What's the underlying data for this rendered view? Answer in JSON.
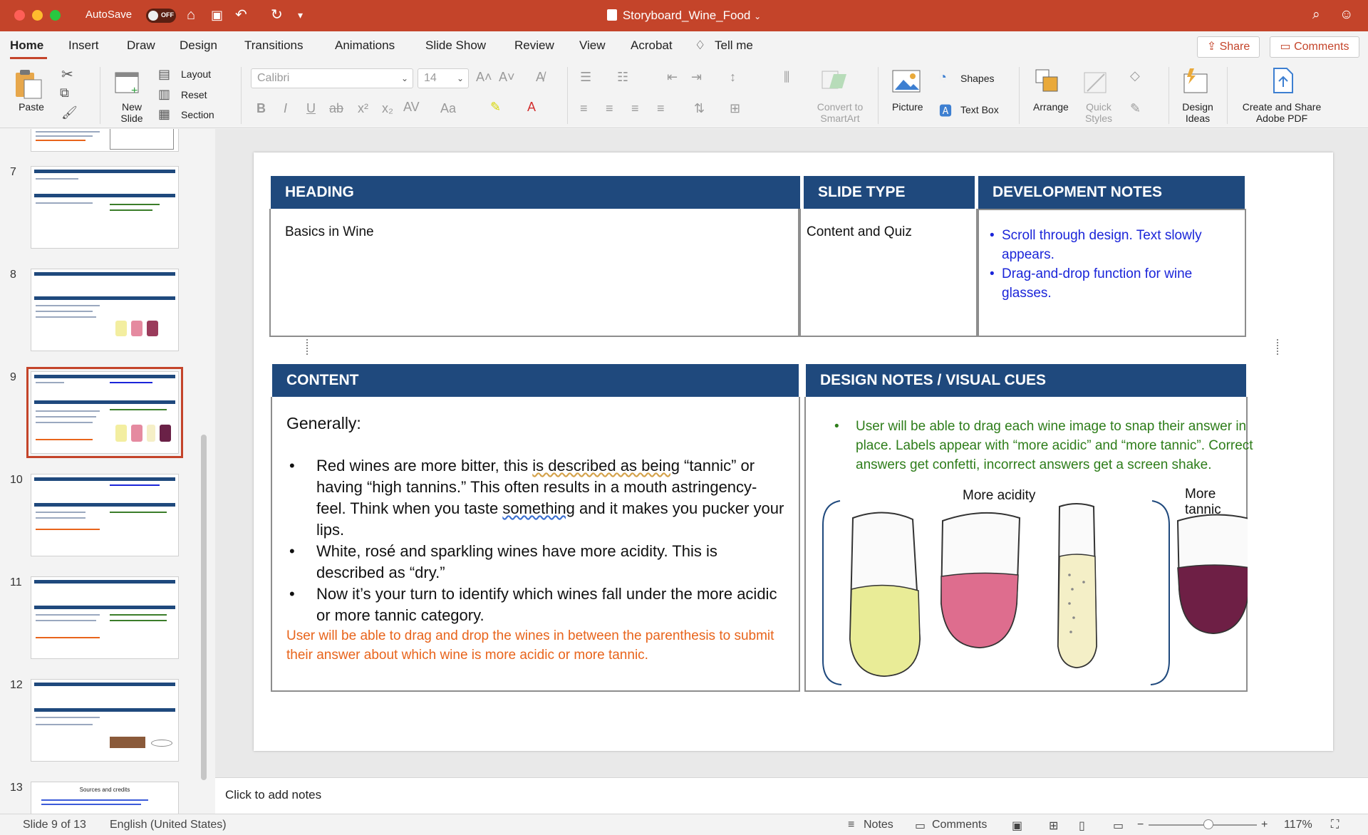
{
  "titlebar": {
    "autosave_label": "AutoSave",
    "autosave_state": "OFF",
    "doc_title": "Storyboard_Wine_Food",
    "accent_color": "#c4442a"
  },
  "ribbon_tabs": [
    "Home",
    "Insert",
    "Draw",
    "Design",
    "Transitions",
    "Animations",
    "Slide Show",
    "Review",
    "View",
    "Acrobat",
    "Tell me"
  ],
  "ribbon_actions": {
    "share": "Share",
    "comments": "Comments"
  },
  "ribbon": {
    "paste": "Paste",
    "new_slide": "New\nSlide",
    "layout": "Layout",
    "reset": "Reset",
    "section": "Section",
    "font_name": "Calibri",
    "font_size": "14",
    "convert_smartart": "Convert to\nSmartArt",
    "picture": "Picture",
    "shapes": "Shapes",
    "text_box": "Text Box",
    "arrange": "Arrange",
    "quick_styles": "Quick\nStyles",
    "design_ideas": "Design\nIdeas",
    "create_share_pdf": "Create and Share\nAdobe PDF"
  },
  "thumbnails": [
    {
      "num": "7"
    },
    {
      "num": "8"
    },
    {
      "num": "9",
      "selected": true
    },
    {
      "num": "10"
    },
    {
      "num": "11"
    },
    {
      "num": "12"
    },
    {
      "num": "13",
      "title": "Sources and credits"
    }
  ],
  "slide": {
    "heading_header": "HEADING",
    "slide_type_header": "SLIDE TYPE",
    "dev_notes_header": "DEVELOPMENT NOTES",
    "heading_value": "Basics in Wine",
    "slide_type_value": "Content and Quiz",
    "dev_notes": [
      "Scroll through design. Text slowly appears.",
      "Drag-and-drop function for wine glasses."
    ],
    "content_header": "CONTENT",
    "design_header": "DESIGN NOTES / VISUAL CUES",
    "content_intro": "Generally:",
    "content_bullets": {
      "b1_a": "Red wines are more bitter, this ",
      "b1_b": "is described as being",
      "b1_c": " “tannic” or having “high tannins.” This often results in a mouth astringency-feel. Think when you taste ",
      "b1_d": "something",
      "b1_e": " and it makes you pucker your lips.",
      "b2": "White, rosé and sparkling wines have more acidity. This is described as “dry.”",
      "b3": "Now it’s your turn to identify which wines fall under the more acidic or more tannic category."
    },
    "content_note": "User will be able to drag and drop the wines in between the parenthesis to submit their answer about which wine is more acidic or more tannic.",
    "design_note": "User will be able to drag each wine image to snap their answer in place. Labels appear with “more acidic” and “more tannic”. Correct answers get confetti, incorrect answers get a screen shake.",
    "label_acidity": "More acidity",
    "label_tannic": "More tannic",
    "colors": {
      "header_bg": "#1f497d",
      "dev_notes_text": "#1b25d9",
      "content_note_text": "#e8641b",
      "design_note_text": "#2e7d1a"
    }
  },
  "notes_placeholder": "Click to add notes",
  "status": {
    "slide_counter": "Slide 9 of 13",
    "language": "English (United States)",
    "notes": "Notes",
    "comments": "Comments",
    "zoom": "117%"
  }
}
